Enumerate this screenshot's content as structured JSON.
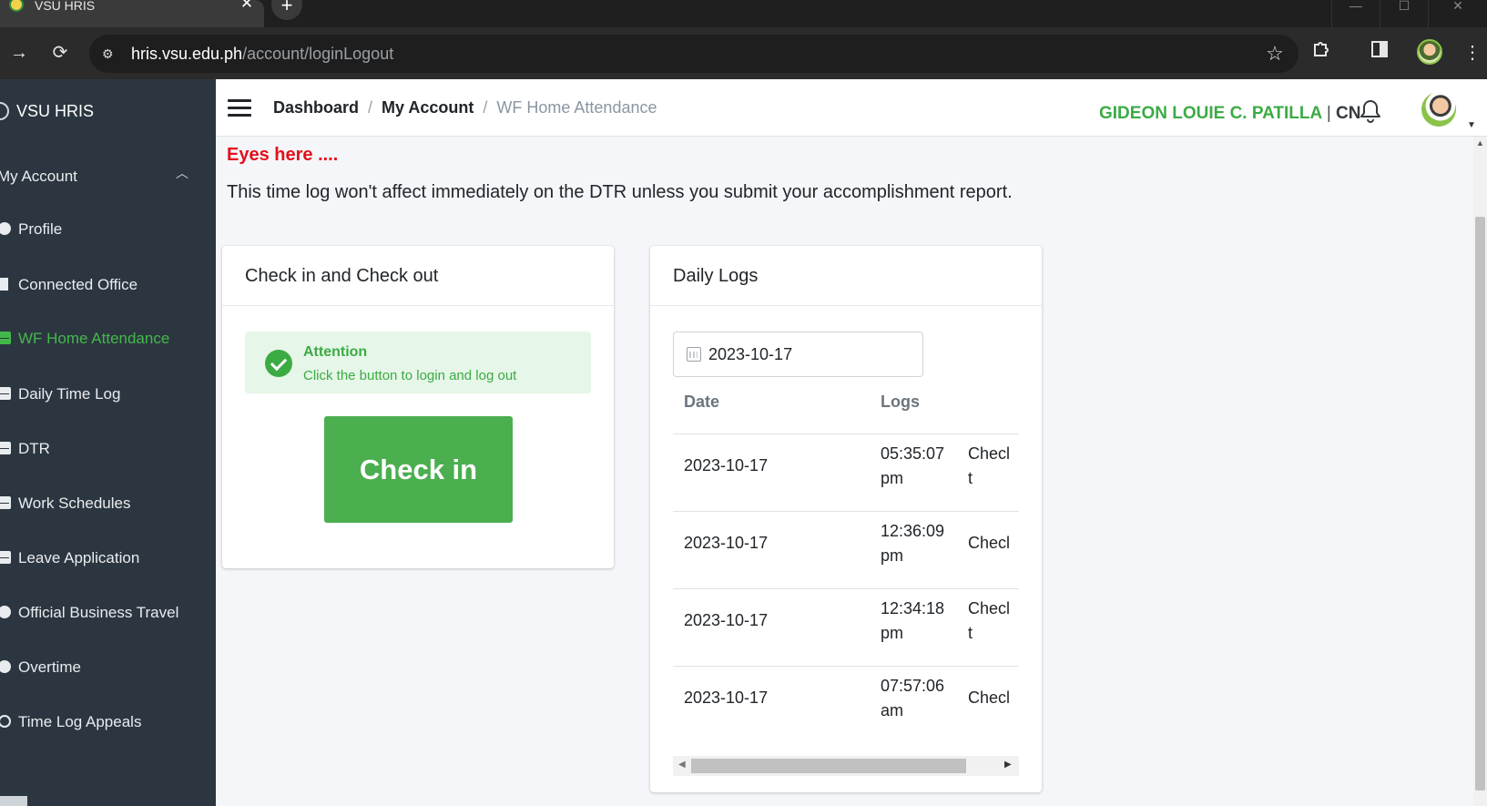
{
  "browser": {
    "tab_title": "VSU HRIS",
    "tab_close": "✕",
    "new_tab": "+",
    "url_host": "hris.vsu.edu.ph",
    "url_path": "/account/loginLogout",
    "win_minimize": "—",
    "win_maximize": "☐",
    "win_close": "✕"
  },
  "sidebar": {
    "brand": "VSU HRIS",
    "section": "My Account",
    "items": [
      {
        "label": "Profile"
      },
      {
        "label": "Connected Office"
      },
      {
        "label": "WF Home Attendance"
      },
      {
        "label": "Daily Time Log"
      },
      {
        "label": "DTR"
      },
      {
        "label": "Work Schedules"
      },
      {
        "label": "Leave Application"
      },
      {
        "label": "Official Business Travel"
      },
      {
        "label": "Overtime"
      },
      {
        "label": "Time Log Appeals"
      }
    ]
  },
  "header": {
    "breadcrumb": [
      "Dashboard",
      "My Account",
      "WF Home Attendance"
    ],
    "user_name": "GIDEON LOUIE C. PATILLA",
    "user_suffix": "CN"
  },
  "notice": {
    "title": "Eyes here ....",
    "text": "This time log won't affect immediately on the DTR unless you submit your accomplishment report."
  },
  "checkin_card": {
    "title": "Check in and Check out",
    "alert_title": "Attention",
    "alert_text": "Click the button to login and log out",
    "button_label": "Check in"
  },
  "logs_card": {
    "title": "Daily Logs",
    "date_value": "2023-10-17",
    "columns": [
      "Date",
      "Logs"
    ],
    "rows": [
      {
        "date": "2023-10-17",
        "time": "05:35:07",
        "ampm": "pm",
        "type_a": "Checl",
        "type_b": "t"
      },
      {
        "date": "2023-10-17",
        "time": "12:36:09",
        "ampm": "pm",
        "type_a": "Checl",
        "type_b": ""
      },
      {
        "date": "2023-10-17",
        "time": "12:34:18",
        "ampm": "pm",
        "type_a": "Checl",
        "type_b": "t"
      },
      {
        "date": "2023-10-17",
        "time": "07:57:06",
        "ampm": "am",
        "type_a": "Checl",
        "type_b": ""
      }
    ]
  },
  "colors": {
    "accent_green": "#3cab44",
    "alert_red": "#e3101b",
    "sidebar_bg": "#2c3640"
  }
}
